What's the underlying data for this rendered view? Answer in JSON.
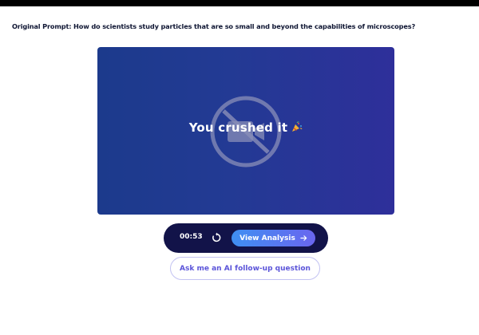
{
  "prompt": {
    "text": "Original Prompt: How do scientists study particles that are so small and beyond the capabilities of microscopes?"
  },
  "video": {
    "message": "You crushed it",
    "overlay_icon": "video-off-icon",
    "celebration_icon": "party-popper-icon"
  },
  "controls": {
    "timer": "00:53",
    "replay_icon": "replay-icon",
    "analysis_label": "View Analysis",
    "analysis_icon": "arrow-right-icon"
  },
  "followup": {
    "label": "Ask me an AI follow-up question"
  },
  "colors": {
    "video_gradient_start": "#1c3a8c",
    "video_gradient_end": "#2e2f9a",
    "controls_bg": "#121349",
    "analysis_gradient_start": "#3f8ff2",
    "analysis_gradient_end": "#6a66ef",
    "followup_text": "#5b54d9",
    "prompt_text": "#0f1633"
  }
}
